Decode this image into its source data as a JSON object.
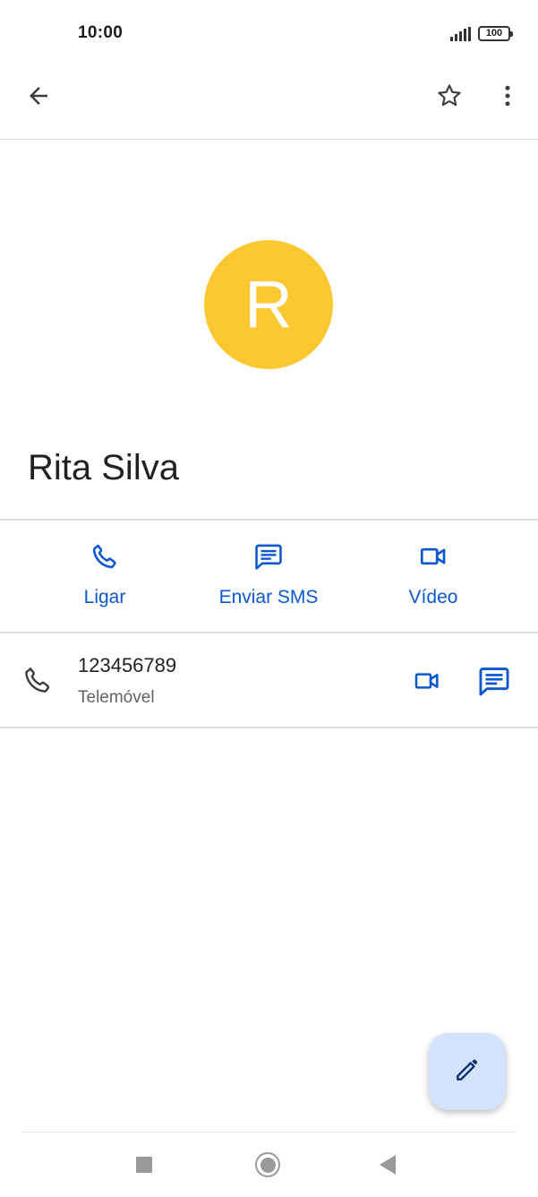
{
  "status_bar": {
    "time": "10:00",
    "battery": "100"
  },
  "app_bar": {
    "icons": [
      "arrow-back-icon",
      "star-outline-icon",
      "more-vert-icon"
    ]
  },
  "contact": {
    "initial": "R",
    "avatar_color": "#FBC832",
    "name": "Rita Silva"
  },
  "actions": [
    {
      "icon": "phone-icon",
      "label": "Ligar"
    },
    {
      "icon": "message-icon",
      "label": "Enviar SMS"
    },
    {
      "icon": "videocam-icon",
      "label": "Vídeo"
    }
  ],
  "phone": {
    "number": "123456789",
    "type": "Telemóvel"
  },
  "colors": {
    "accent": "#0B57D0",
    "fab_bg": "#D3E3FD",
    "nav_gray": "#9A9A9A"
  },
  "fab": {
    "icon": "edit-pencil-icon"
  },
  "nav_bar": {
    "icons": [
      "recents-square-icon",
      "home-circle-icon",
      "back-triangle-icon"
    ]
  }
}
